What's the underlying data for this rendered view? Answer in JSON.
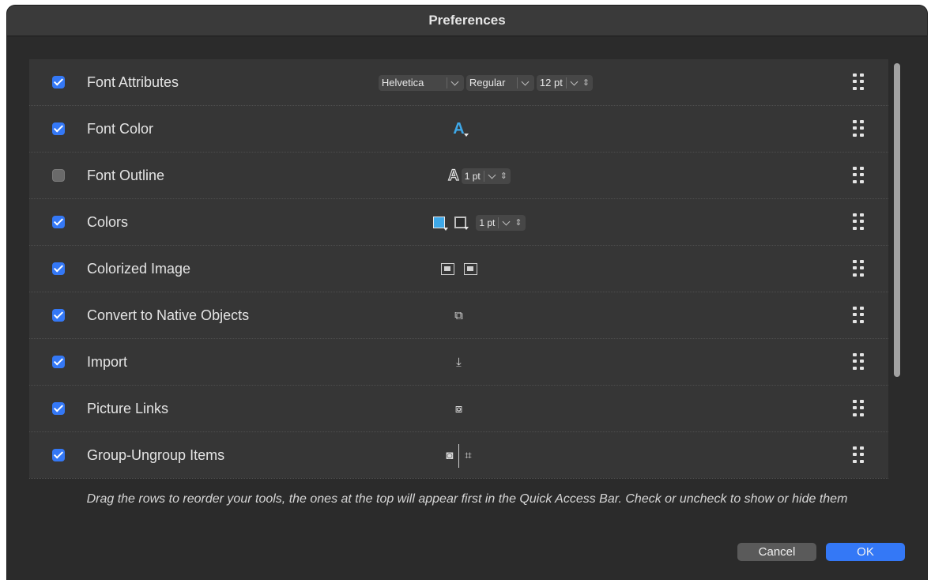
{
  "window": {
    "title": "Preferences"
  },
  "rows": [
    {
      "label": "Font Attributes",
      "checked": true
    },
    {
      "label": "Font Color",
      "checked": true
    },
    {
      "label": "Font Outline",
      "checked": false
    },
    {
      "label": "Colors",
      "checked": true
    },
    {
      "label": "Colorized Image",
      "checked": true
    },
    {
      "label": "Convert to Native Objects",
      "checked": true
    },
    {
      "label": "Import",
      "checked": true
    },
    {
      "label": "Picture Links",
      "checked": true
    },
    {
      "label": "Group-Ungroup Items",
      "checked": true
    }
  ],
  "font_attributes": {
    "family": "Helvetica",
    "style": "Regular",
    "size": "12 pt"
  },
  "font_outline": {
    "width": "1 pt"
  },
  "colors": {
    "width": "1 pt"
  },
  "hint": "Drag the rows to reorder your tools, the ones at the top will appear first in the Quick Access Bar. Check or uncheck to show or hide them",
  "buttons": {
    "cancel": "Cancel",
    "ok": "OK"
  },
  "colors_accent": {
    "checkbox": "#3478f6",
    "font_color": "#3ea8e8",
    "ok_button": "#3478f6"
  }
}
